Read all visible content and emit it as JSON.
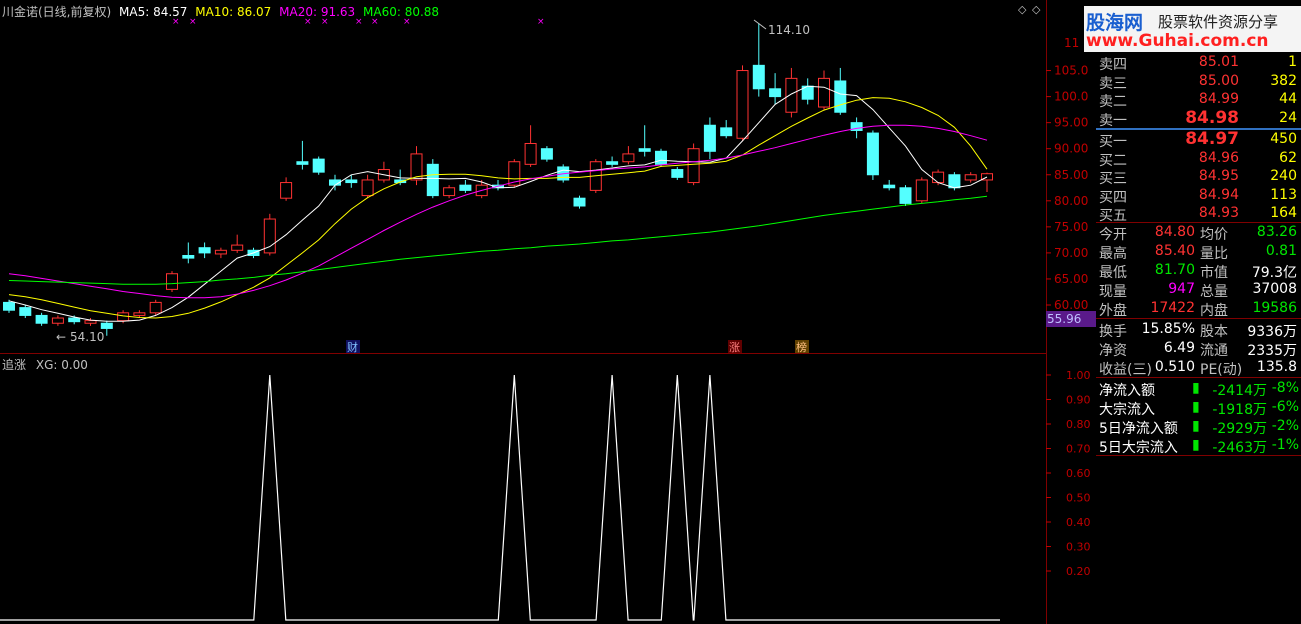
{
  "header": {
    "title": "川金诺(日线,前复权)",
    "ma5": "MA5: 84.57",
    "ma10": "MA10: 86.07",
    "ma20": "MA20: 91.63",
    "ma60": "MA60: 80.88",
    "colors": {
      "ma5": "#ffffff",
      "ma10": "#ffff00",
      "ma20": "#ff00ff",
      "ma60": "#00ff00"
    }
  },
  "price_axis": [
    "105.0",
    "100.0",
    "95.00",
    "90.00",
    "85.00",
    "80.00",
    "75.00",
    "70.00",
    "65.00",
    "60.00"
  ],
  "price_axis_top": "11",
  "current_price_tag": "55.96",
  "high_label": "114.10",
  "low_label": "54.10",
  "event_markers": {
    "cai": "财",
    "zhang": "涨",
    "bang": "榜"
  },
  "indicator": {
    "title": "追涨",
    "value": "XG: 0.00",
    "axis": [
      "1.00",
      "0.90",
      "0.80",
      "0.70",
      "0.60",
      "0.50",
      "0.40",
      "0.30",
      "0.20"
    ]
  },
  "logo": {
    "brand": "股海网",
    "slogan": "股票软件资源分享",
    "url": "www.Guhai.com.cn"
  },
  "order_book": {
    "asks": [
      {
        "label": "卖四",
        "price": "85.01",
        "vol": "1"
      },
      {
        "label": "卖三",
        "price": "85.00",
        "vol": "382"
      },
      {
        "label": "卖二",
        "price": "84.99",
        "vol": "44"
      },
      {
        "label": "卖一",
        "price": "84.98",
        "vol": "24"
      }
    ],
    "bids": [
      {
        "label": "买一",
        "price": "84.97",
        "vol": "450"
      },
      {
        "label": "买二",
        "price": "84.96",
        "vol": "62"
      },
      {
        "label": "买三",
        "price": "84.95",
        "vol": "240"
      },
      {
        "label": "买四",
        "price": "84.94",
        "vol": "113"
      },
      {
        "label": "买五",
        "price": "84.93",
        "vol": "164"
      }
    ]
  },
  "stats": [
    {
      "l1": "今开",
      "v1": "84.80",
      "c1": "red",
      "l2": "均价",
      "v2": "83.26",
      "c2": "green"
    },
    {
      "l1": "最高",
      "v1": "85.40",
      "c1": "red",
      "l2": "量比",
      "v2": "0.81",
      "c2": "green"
    },
    {
      "l1": "最低",
      "v1": "81.70",
      "c1": "green",
      "l2": "市值",
      "v2": "79.3亿",
      "c2": "white"
    },
    {
      "l1": "现量",
      "v1": "947",
      "c1": "magenta",
      "l2": "总量",
      "v2": "37008",
      "c2": "white"
    },
    {
      "l1": "外盘",
      "v1": "17422",
      "c1": "red",
      "l2": "内盘",
      "v2": "19586",
      "c2": "green"
    }
  ],
  "stats2": [
    {
      "l1": "换手",
      "v1": "15.85%",
      "l2": "股本",
      "v2": "9336万"
    },
    {
      "l1": "净资",
      "v1": "6.49",
      "l2": "流通",
      "v2": "2335万"
    },
    {
      "l1": "收益(三)",
      "v1": "0.510",
      "l2": "PE(动)",
      "v2": "135.8"
    }
  ],
  "flows": [
    {
      "label": "净流入额",
      "value": "-2414万",
      "pct": "-8%"
    },
    {
      "label": "大宗流入",
      "value": "-1918万",
      "pct": "-6%"
    },
    {
      "label": "5日净流入额",
      "value": "-2929万",
      "pct": "-2%"
    },
    {
      "label": "5日大宗流入",
      "value": "-2463万",
      "pct": "-1%"
    }
  ],
  "chart_data": {
    "type": "candlestick",
    "ylim": [
      53,
      115
    ],
    "candles": [
      {
        "o": 60.5,
        "c": 59.0,
        "h": 61.0,
        "l": 58.5
      },
      {
        "o": 59.5,
        "c": 58.0,
        "h": 60.0,
        "l": 57.5
      },
      {
        "o": 58.0,
        "c": 56.5,
        "h": 58.5,
        "l": 56.0
      },
      {
        "o": 56.5,
        "c": 57.5,
        "h": 58.0,
        "l": 56.0
      },
      {
        "o": 57.5,
        "c": 56.8,
        "h": 58.0,
        "l": 56.3
      },
      {
        "o": 56.5,
        "c": 57.0,
        "h": 57.5,
        "l": 56.0
      },
      {
        "o": 56.5,
        "c": 55.5,
        "h": 57.0,
        "l": 54.1
      },
      {
        "o": 57.0,
        "c": 58.5,
        "h": 59.0,
        "l": 56.5
      },
      {
        "o": 58.0,
        "c": 58.5,
        "h": 59.0,
        "l": 57.5
      },
      {
        "o": 58.5,
        "c": 60.5,
        "h": 61.0,
        "l": 58.0
      },
      {
        "o": 63.0,
        "c": 66.0,
        "h": 66.5,
        "l": 62.5
      },
      {
        "o": 69.5,
        "c": 69.0,
        "h": 72.0,
        "l": 68.0
      },
      {
        "o": 71.0,
        "c": 70.0,
        "h": 72.0,
        "l": 69.0
      },
      {
        "o": 69.8,
        "c": 70.5,
        "h": 71.0,
        "l": 69.0
      },
      {
        "o": 70.5,
        "c": 71.5,
        "h": 73.5,
        "l": 70.0
      },
      {
        "o": 70.5,
        "c": 69.5,
        "h": 71.0,
        "l": 69.0
      },
      {
        "o": 70.0,
        "c": 76.5,
        "h": 77.5,
        "l": 69.5
      },
      {
        "o": 80.5,
        "c": 83.5,
        "h": 84.5,
        "l": 80.0
      },
      {
        "o": 87.5,
        "c": 87.0,
        "h": 91.5,
        "l": 86.0
      },
      {
        "o": 88.0,
        "c": 85.5,
        "h": 88.5,
        "l": 85.0
      },
      {
        "o": 84.0,
        "c": 83.0,
        "h": 85.0,
        "l": 82.0
      },
      {
        "o": 84.0,
        "c": 83.5,
        "h": 85.0,
        "l": 82.5
      },
      {
        "o": 81.0,
        "c": 84.0,
        "h": 85.0,
        "l": 80.5
      },
      {
        "o": 84.0,
        "c": 86.0,
        "h": 87.5,
        "l": 83.5
      },
      {
        "o": 84.0,
        "c": 83.5,
        "h": 86.0,
        "l": 83.0
      },
      {
        "o": 84.0,
        "c": 89.0,
        "h": 90.5,
        "l": 83.0
      },
      {
        "o": 87.0,
        "c": 81.0,
        "h": 88.0,
        "l": 80.5
      },
      {
        "o": 81.0,
        "c": 82.5,
        "h": 83.0,
        "l": 80.5
      },
      {
        "o": 83.0,
        "c": 82.0,
        "h": 84.0,
        "l": 81.5
      },
      {
        "o": 81.0,
        "c": 83.0,
        "h": 84.0,
        "l": 80.5
      },
      {
        "o": 83.0,
        "c": 82.5,
        "h": 84.0,
        "l": 82.0
      },
      {
        "o": 83.0,
        "c": 87.5,
        "h": 88.0,
        "l": 82.5
      },
      {
        "o": 87.0,
        "c": 91.0,
        "h": 94.5,
        "l": 86.5
      },
      {
        "o": 90.0,
        "c": 88.0,
        "h": 90.5,
        "l": 87.5
      },
      {
        "o": 86.5,
        "c": 84.0,
        "h": 87.0,
        "l": 83.5
      },
      {
        "o": 80.5,
        "c": 79.0,
        "h": 81.0,
        "l": 78.5
      },
      {
        "o": 82.0,
        "c": 87.5,
        "h": 88.0,
        "l": 81.5
      },
      {
        "o": 87.5,
        "c": 87.0,
        "h": 88.5,
        "l": 86.5
      },
      {
        "o": 87.5,
        "c": 89.0,
        "h": 90.5,
        "l": 87.0
      },
      {
        "o": 90.0,
        "c": 89.5,
        "h": 94.5,
        "l": 88.5
      },
      {
        "o": 89.5,
        "c": 87.0,
        "h": 90.0,
        "l": 86.5
      },
      {
        "o": 86.0,
        "c": 84.5,
        "h": 86.5,
        "l": 84.0
      },
      {
        "o": 83.5,
        "c": 90.0,
        "h": 91.0,
        "l": 83.0
      },
      {
        "o": 94.5,
        "c": 89.5,
        "h": 96.0,
        "l": 88.0
      },
      {
        "o": 94.0,
        "c": 92.5,
        "h": 95.5,
        "l": 92.0
      },
      {
        "o": 92.0,
        "c": 105.0,
        "h": 106.0,
        "l": 91.5
      },
      {
        "o": 106.0,
        "c": 101.5,
        "h": 114.1,
        "l": 100.0
      },
      {
        "o": 101.5,
        "c": 100.0,
        "h": 104.5,
        "l": 98.5
      },
      {
        "o": 97.0,
        "c": 103.5,
        "h": 105.5,
        "l": 96.0
      },
      {
        "o": 102.0,
        "c": 99.5,
        "h": 103.5,
        "l": 98.5
      },
      {
        "o": 98.0,
        "c": 103.5,
        "h": 105.0,
        "l": 97.5
      },
      {
        "o": 103.0,
        "c": 97.0,
        "h": 105.5,
        "l": 96.5
      },
      {
        "o": 95.0,
        "c": 93.5,
        "h": 96.0,
        "l": 92.0
      },
      {
        "o": 93.0,
        "c": 85.0,
        "h": 93.5,
        "l": 84.0
      },
      {
        "o": 83.0,
        "c": 82.5,
        "h": 84.0,
        "l": 82.0
      },
      {
        "o": 82.5,
        "c": 79.5,
        "h": 83.0,
        "l": 79.0
      },
      {
        "o": 80.0,
        "c": 84.0,
        "h": 84.5,
        "l": 79.5
      },
      {
        "o": 83.5,
        "c": 85.5,
        "h": 86.0,
        "l": 83.0
      },
      {
        "o": 85.0,
        "c": 82.5,
        "h": 85.5,
        "l": 82.0
      },
      {
        "o": 84.0,
        "c": 85.0,
        "h": 85.5,
        "l": 83.5
      },
      {
        "o": 84.0,
        "c": 85.2,
        "h": 85.4,
        "l": 81.7
      }
    ],
    "ma5": [
      60.8,
      60.0,
      59.1,
      58.4,
      57.7,
      57.1,
      56.9,
      56.9,
      57.1,
      58.0,
      59.5,
      61.5,
      64.0,
      66.5,
      69.0,
      70.0,
      71.2,
      73.5,
      76.3,
      79.0,
      83.0,
      85.0,
      85.6,
      85.0,
      84.4,
      84.3,
      84.3,
      84.2,
      84.3,
      83.6,
      82.5,
      82.6,
      83.7,
      84.9,
      85.9,
      85.6,
      85.9,
      86.3,
      86.7,
      86.9,
      87.8,
      87.6,
      87.5,
      87.4,
      88.2,
      91.5,
      95.0,
      98.5,
      100.5,
      102.0,
      101.8,
      100.5,
      100.2,
      97.5,
      94.0,
      90.5,
      86.0,
      83.5,
      82.5,
      83.0,
      84.57
    ],
    "ma10": [
      62.0,
      61.6,
      61.0,
      60.3,
      59.6,
      58.9,
      58.4,
      57.9,
      57.6,
      57.5,
      57.8,
      58.4,
      59.4,
      60.6,
      62.0,
      63.4,
      65.2,
      67.6,
      70.0,
      72.5,
      75.6,
      78.4,
      80.6,
      82.3,
      83.6,
      84.6,
      85.0,
      85.1,
      85.1,
      84.8,
      84.4,
      84.2,
      84.3,
      84.3,
      84.5,
      84.5,
      84.8,
      85.1,
      85.4,
      85.7,
      86.6,
      86.8,
      87.0,
      87.2,
      87.6,
      88.8,
      90.7,
      92.5,
      94.3,
      95.9,
      97.4,
      98.4,
      99.3,
      99.8,
      99.7,
      99.0,
      97.9,
      96.4,
      94.1,
      90.5,
      86.07
    ],
    "ma20": [
      66.0,
      65.6,
      65.1,
      64.6,
      64.1,
      63.6,
      63.1,
      62.6,
      62.2,
      61.8,
      61.5,
      61.4,
      61.4,
      61.6,
      62.1,
      62.8,
      63.7,
      64.8,
      66.1,
      67.5,
      69.2,
      70.9,
      72.6,
      74.3,
      75.9,
      77.4,
      78.8,
      80.0,
      81.1,
      82.0,
      82.8,
      83.6,
      84.2,
      84.7,
      85.2,
      85.5,
      85.8,
      86.1,
      86.3,
      86.5,
      86.9,
      87.2,
      87.5,
      87.8,
      88.2,
      88.8,
      89.5,
      90.2,
      91.0,
      91.8,
      92.6,
      93.3,
      93.9,
      94.3,
      94.5,
      94.5,
      94.3,
      93.9,
      93.3,
      92.5,
      91.63
    ],
    "ma60": [
      64.7,
      64.6,
      64.5,
      64.4,
      64.3,
      64.2,
      64.1,
      64.0,
      64.0,
      64.0,
      64.1,
      64.3,
      64.5,
      64.8,
      65.0,
      65.3,
      65.7,
      66.0,
      66.4,
      66.8,
      67.2,
      67.6,
      68.0,
      68.4,
      68.8,
      69.1,
      69.4,
      69.7,
      70.0,
      70.3,
      70.5,
      70.8,
      71.0,
      71.3,
      71.5,
      71.7,
      72.0,
      72.3,
      72.5,
      72.8,
      73.1,
      73.4,
      73.7,
      74.0,
      74.4,
      74.8,
      75.2,
      75.7,
      76.2,
      76.7,
      77.2,
      77.6,
      78.0,
      78.4,
      78.8,
      79.2,
      79.5,
      79.8,
      80.2,
      80.5,
      80.88
    ],
    "indicator_spikes": [
      16,
      31,
      37,
      41,
      43
    ]
  }
}
